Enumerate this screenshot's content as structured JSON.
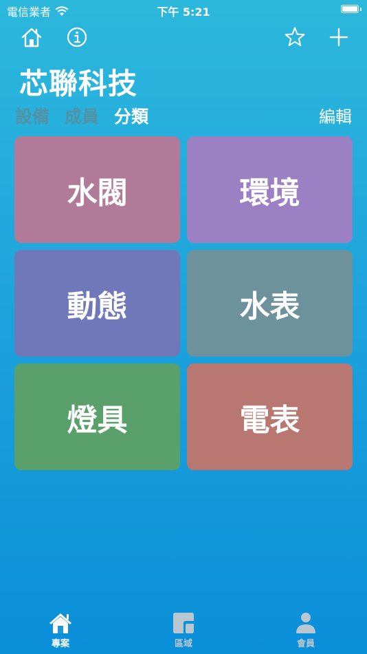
{
  "status_bar": {
    "carrier": "電信業者",
    "time": "下午 5:21"
  },
  "header": {
    "icons": [
      "home-icon",
      "info-icon",
      "star-icon",
      "plus-icon"
    ],
    "title": "芯聯科技"
  },
  "segments": [
    {
      "label": "設備",
      "active": false
    },
    {
      "label": "成員",
      "active": false
    },
    {
      "label": "分類",
      "active": true
    }
  ],
  "edit_label": "編輯",
  "categories": [
    {
      "label": "水閥",
      "color": "#b07a98"
    },
    {
      "label": "環境",
      "color": "#9b80c3"
    },
    {
      "label": "動態",
      "color": "#7178ba"
    },
    {
      "label": "水表",
      "color": "#6e929c"
    },
    {
      "label": "燈具",
      "color": "#59a06b"
    },
    {
      "label": "電表",
      "color": "#b87770"
    }
  ],
  "tab_bar": {
    "tabs": [
      {
        "label": "專案",
        "icon": "home-icon",
        "active": true
      },
      {
        "label": "區域",
        "icon": "area-icon",
        "active": false
      },
      {
        "label": "會員",
        "icon": "person-icon",
        "active": false
      }
    ]
  }
}
